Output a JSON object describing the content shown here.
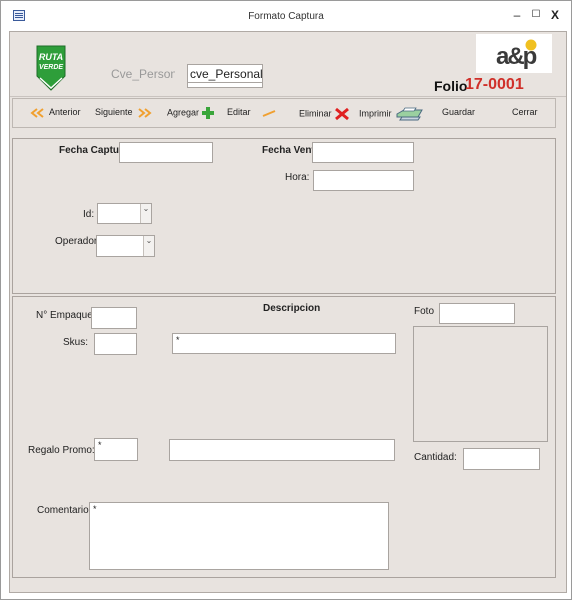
{
  "window": {
    "title": "Formato Captura",
    "min_symbol": "–",
    "max_symbol": "☐",
    "close_symbol": "X"
  },
  "header": {
    "cve_label": "Cve_Personal",
    "cve_value": "cve_Personal",
    "folio_label": "Folio",
    "folio_value": "17-0001",
    "logo_left_text": "RUTA VERDE",
    "logo_right_text": "a&p"
  },
  "toolbar": {
    "anterior": "Anterior",
    "siguiente": "Siguiente",
    "agregar": "Agregar",
    "editar": "Editar",
    "eliminar": "Eliminar",
    "imprimir": "Imprimir",
    "guardar": "Guardar",
    "cerrar": "Cerrar"
  },
  "section1": {
    "fecha_captura": "Fecha Captura:",
    "fecha_venta": "Fecha Venta:",
    "hora": "Hora:",
    "id": "Id:",
    "operador": "Operador:"
  },
  "section2": {
    "empaque": "N° Empaque:",
    "descripcion": "Descripcion",
    "foto": "Foto",
    "skus": "Skus:",
    "skus_value": "*",
    "regalo": "Regalo Promo:",
    "regalo_value": "*",
    "cantidad": "Cantidad:",
    "comentarios": "Comentarios:",
    "comentarios_value": "*"
  },
  "colors": {
    "folio_red": "#d0302a",
    "form_bg": "#e8e3df",
    "logo_green": "#2e9e3a"
  },
  "icons": [
    "app-form-icon",
    "double-left-arrow-icon",
    "double-right-arrow-icon",
    "plus-icon",
    "pencil-icon",
    "red-x-icon",
    "printer-icon"
  ]
}
